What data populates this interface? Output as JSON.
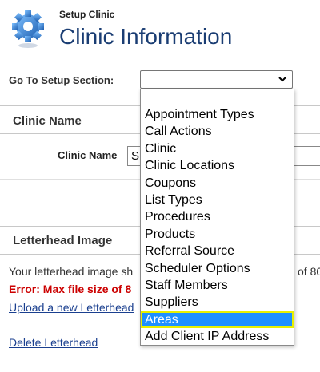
{
  "header": {
    "breadcrumb": "Setup Clinic",
    "title": "Clinic Information"
  },
  "goto": {
    "label": "Go To Setup Section:",
    "selected_value": ""
  },
  "clinic_name_section": {
    "title": "Clinic Name",
    "field_label": "Clinic Name",
    "field_value": "S"
  },
  "letterhead_section": {
    "title": "Letterhead Image",
    "info_text": "Your letterhead image sh",
    "info_text_end": "of 80",
    "error_text": "Error: Max file size of 8",
    "upload_link": "Upload a new Letterhead",
    "delete_link": "Delete Letterhead"
  },
  "dropdown": {
    "options": [
      "Appointment Types",
      "Call Actions",
      "Clinic",
      "Clinic Locations",
      "Coupons",
      "List Types",
      "Procedures",
      "Products",
      "Referral Source",
      "Scheduler Options",
      "Staff Members",
      "Suppliers",
      "Areas",
      "Add Client IP Address"
    ],
    "highlighted": "Areas"
  },
  "colors": {
    "title": "#1a3d73",
    "error": "#cc0000",
    "link": "#1a3f8f",
    "highlight": "#1e90ff",
    "highlight_outline": "#e8f000",
    "gear": "#2a7ccc"
  },
  "icons": {
    "logo": "gear-icon",
    "select": "chevron-down-icon"
  }
}
